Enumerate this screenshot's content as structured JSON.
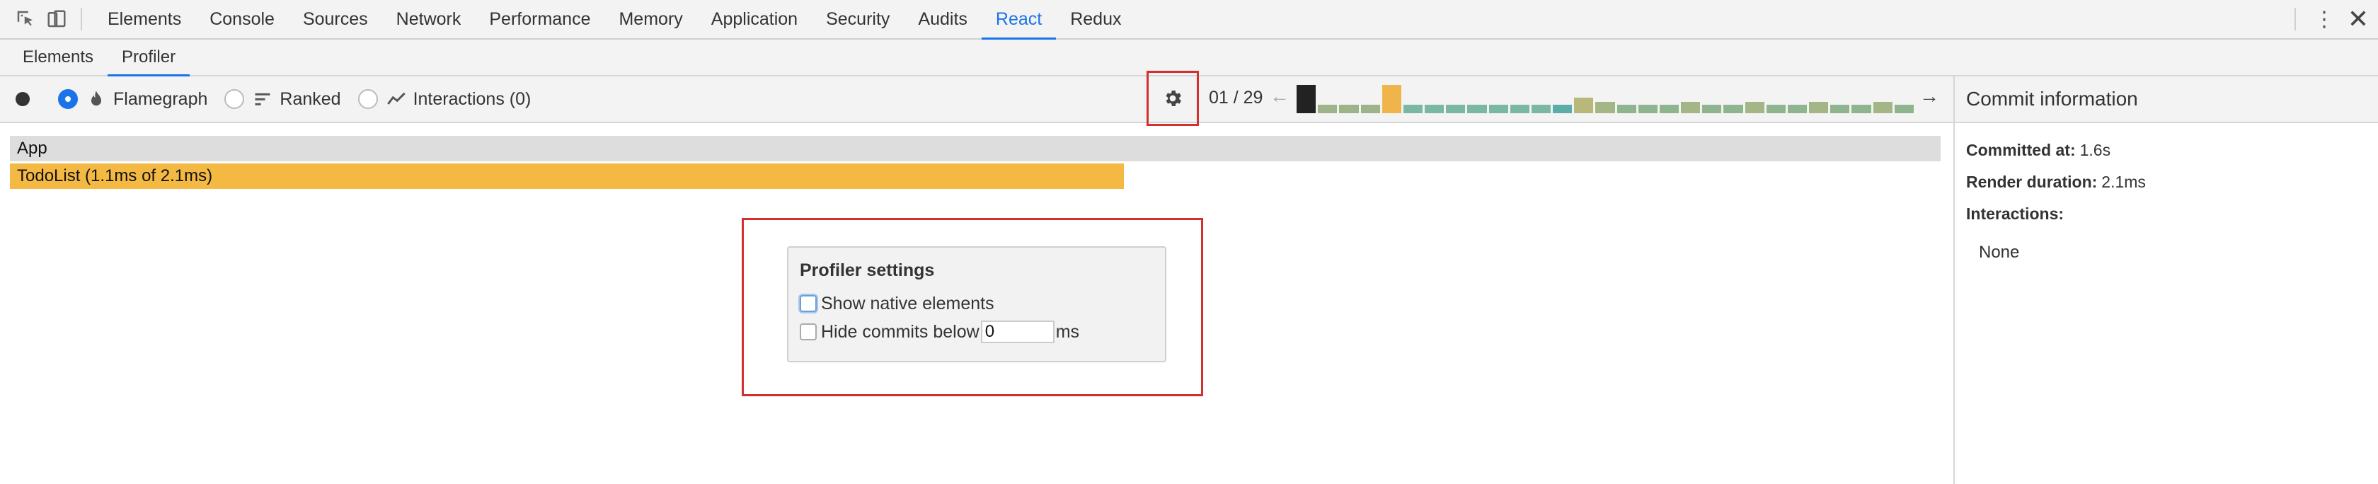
{
  "devtools_tabs": [
    "Elements",
    "Console",
    "Sources",
    "Network",
    "Performance",
    "Memory",
    "Application",
    "Security",
    "Audits",
    "React",
    "Redux"
  ],
  "active_devtools_tab": "React",
  "react_tabs": [
    "Elements",
    "Profiler"
  ],
  "active_react_tab": "Profiler",
  "profiler": {
    "modes": {
      "flamegraph": "Flamegraph",
      "ranked": "Ranked",
      "interactions": "Interactions (0)"
    },
    "commit_counter": "01 / 29",
    "commit_bars": [
      {
        "h": 1.0,
        "color": "#222222"
      },
      {
        "h": 0.3,
        "color": "#9db38a"
      },
      {
        "h": 0.3,
        "color": "#9db38a"
      },
      {
        "h": 0.3,
        "color": "#9db38a"
      },
      {
        "h": 1.0,
        "color": "#f0b54a"
      },
      {
        "h": 0.3,
        "color": "#7bb7a5"
      },
      {
        "h": 0.3,
        "color": "#7bb7a5"
      },
      {
        "h": 0.3,
        "color": "#7bb7a5"
      },
      {
        "h": 0.3,
        "color": "#7bb7a5"
      },
      {
        "h": 0.3,
        "color": "#7bb7a5"
      },
      {
        "h": 0.3,
        "color": "#7bb7a5"
      },
      {
        "h": 0.3,
        "color": "#7bb7a5"
      },
      {
        "h": 0.3,
        "color": "#5aaea7"
      },
      {
        "h": 0.55,
        "color": "#b7b87a"
      },
      {
        "h": 0.4,
        "color": "#a4b685"
      },
      {
        "h": 0.3,
        "color": "#8fb58f"
      },
      {
        "h": 0.3,
        "color": "#8fb58f"
      },
      {
        "h": 0.3,
        "color": "#8fb58f"
      },
      {
        "h": 0.4,
        "color": "#a4b685"
      },
      {
        "h": 0.3,
        "color": "#8fb58f"
      },
      {
        "h": 0.3,
        "color": "#8fb58f"
      },
      {
        "h": 0.4,
        "color": "#a4b685"
      },
      {
        "h": 0.3,
        "color": "#8fb58f"
      },
      {
        "h": 0.3,
        "color": "#8fb58f"
      },
      {
        "h": 0.4,
        "color": "#a4b685"
      },
      {
        "h": 0.3,
        "color": "#8fb58f"
      },
      {
        "h": 0.3,
        "color": "#8fb58f"
      },
      {
        "h": 0.4,
        "color": "#a4b685"
      },
      {
        "h": 0.3,
        "color": "#8fb58f"
      }
    ],
    "flamegraph": {
      "root_label": "App",
      "child_label": "TodoList (1.1ms of 2.1ms)"
    }
  },
  "settings": {
    "title": "Profiler settings",
    "show_native_label": "Show native elements",
    "hide_commits_label": "Hide commits below",
    "hide_commits_value": "0",
    "ms_unit": "ms"
  },
  "commit_info": {
    "title": "Commit information",
    "committed_at_label": "Committed at:",
    "committed_at_value": "1.6s",
    "render_duration_label": "Render duration:",
    "render_duration_value": "2.1ms",
    "interactions_label": "Interactions:",
    "interactions_value": "None"
  },
  "colors": {
    "accent": "#1a73e8",
    "highlight_box": "#d32f2f",
    "flame_app": "#dddddd",
    "flame_todolist": "#f4b942"
  }
}
